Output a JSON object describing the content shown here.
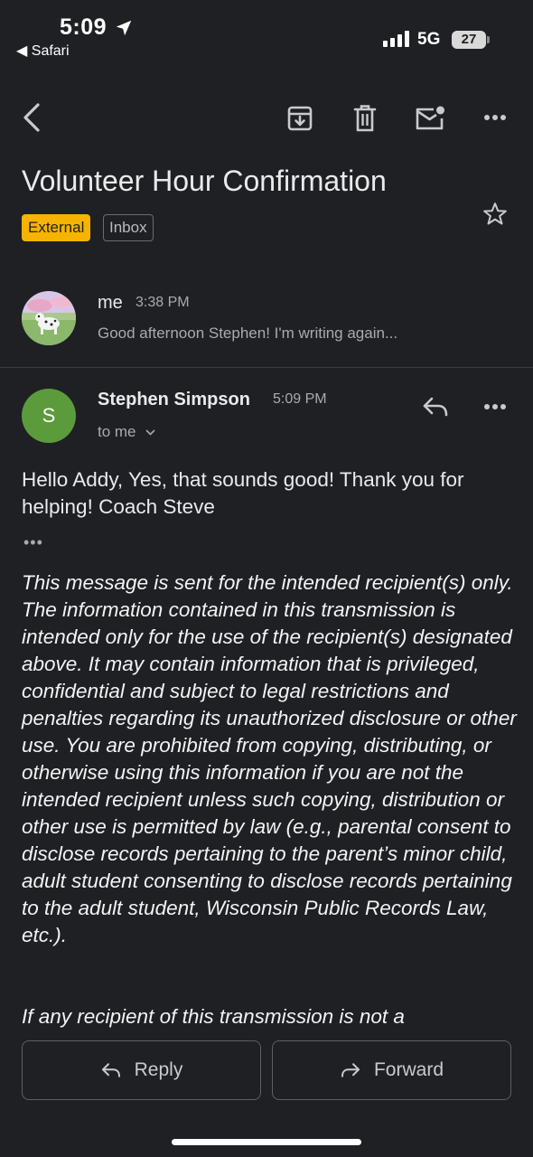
{
  "status_bar": {
    "time": "5:09",
    "back_app": "Safari",
    "network": "5G",
    "battery": "27"
  },
  "toolbar": {
    "icons": [
      "back-arrow-icon",
      "archive-icon",
      "trash-icon",
      "mark-unread-icon",
      "more-icon"
    ]
  },
  "email": {
    "subject": "Volunteer Hour Confirmation",
    "labels": [
      "External",
      "Inbox"
    ],
    "label_colors": {
      "External": "#f6b400",
      "Inbox": "#6b6c72"
    }
  },
  "collapsed_message": {
    "sender": "me",
    "time": "3:38 PM",
    "snippet": "Good afternoon Stephen! I'm writing again..."
  },
  "expanded_message": {
    "avatar_letter": "S",
    "avatar_color": "#5b9b3c",
    "sender": "Stephen Simpson",
    "time": "5:09 PM",
    "recipient": "to me",
    "body": "Hello Addy, Yes, that sounds good!  Thank you for helping!  Coach Steve",
    "trimmed_indicator": "•••",
    "disclaimer": "This message is sent for the intended recipient(s) only. The information contained in this transmission is intended only for the use of the recipient(s) designated above.  It may contain information that is privileged, confidential and subject to legal restrictions and penalties regarding its unauthorized disclosure or other use. You are prohibited from copying, distributing, or otherwise using this information if you are not the intended recipient unless such copying, distribution or other use is permitted by law (e.g., parental consent to disclose records pertaining to the parent’s minor child, adult student consenting to disclose records pertaining to the adult student, Wisconsin Public Records Law, etc.).",
    "disclaimer_continued": "If any recipient of this transmission is not a"
  },
  "actions": {
    "reply": "Reply",
    "forward": "Forward"
  }
}
